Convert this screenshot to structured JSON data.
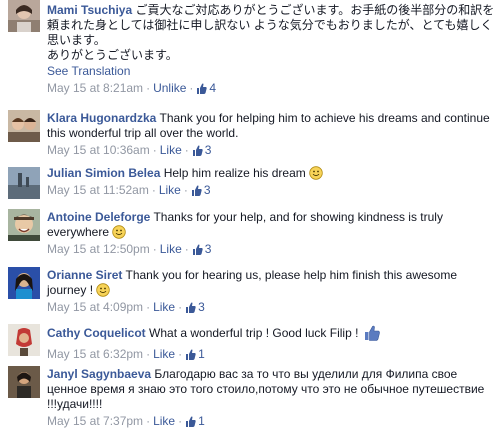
{
  "comments": [
    {
      "name": "Mami Tsuchiya",
      "text": "ご貢大なご対応ありがとうございます。お手紙の後半部分の和訳を頼まれた身としては御社に申し訳ない ような気分でもおりましたが、とても嬉しく思います。",
      "text2": "ありがとうございます。",
      "see_translation": "See Translation",
      "time": "May 15 at 8:21am",
      "unlike": "Unlike",
      "likes": "4"
    },
    {
      "name": "Klara Hugonardzka",
      "text": "Thank you for helping him to achieve his dreams and continue this wonderful trip all over the world.",
      "time": "May 15 at 10:36am",
      "like": "Like",
      "likes": "3"
    },
    {
      "name": "Julian Simion Belea",
      "text": "Help him realize his dream",
      "time": "May 15 at 11:52am",
      "like": "Like",
      "likes": "3"
    },
    {
      "name": "Antoine Deleforge",
      "text": "Thanks for your help, and for showing kindness is truly everywhere",
      "time": "May 15 at 12:50pm",
      "like": "Like",
      "likes": "3"
    },
    {
      "name": "Orianne Siret",
      "text": "Thank you for hearing us, please help him finish this awesome journey !",
      "time": "May 15 at 4:09pm",
      "like": "Like",
      "likes": "3"
    },
    {
      "name": "Cathy Coquelicot",
      "text": "What a wonderful trip ! Good luck Filip !",
      "time": "May 15 at 6:32pm",
      "like": "Like",
      "likes": "1"
    },
    {
      "name": "Janyl Sagynbaeva",
      "text": "Благодарю вас за то что вы уделили для Филипа свое ценное время я знаю это того стоило,потому что это не обычное путешествие !!!удачи!!!!",
      "time": "May 15 at 7:37pm",
      "like": "Like",
      "likes": "1"
    }
  ],
  "colors": {
    "link": "#3b5998",
    "meta": "#9197a3",
    "text": "#141823"
  }
}
